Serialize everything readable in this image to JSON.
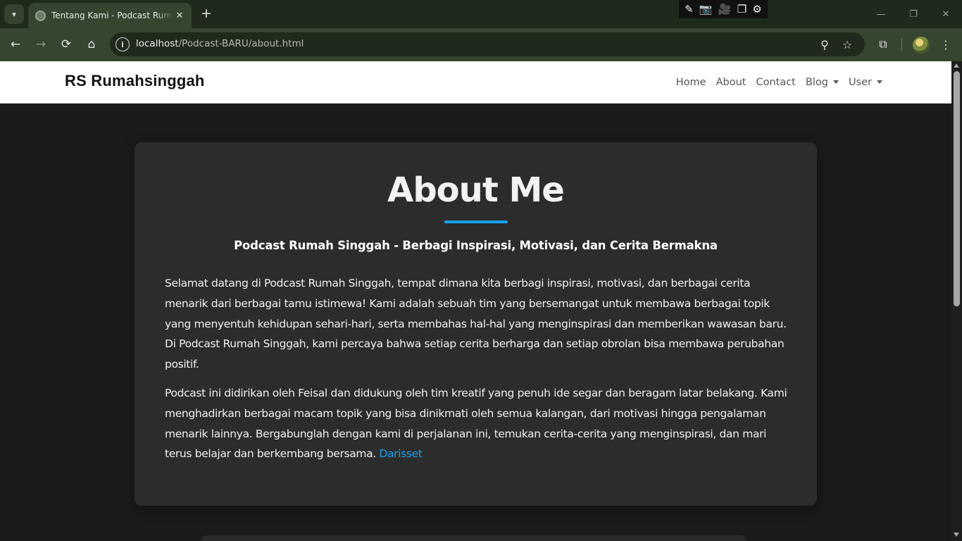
{
  "browser": {
    "tab": {
      "title": "Tentang Kami - Podcast Rumah Singgah",
      "favicon": "globe-icon"
    },
    "url": {
      "host": "localhost",
      "path": "/Podcast-BARU/about.html"
    },
    "icons": {
      "tab_list": "▾",
      "tab_close": "✕",
      "new_tab": "+",
      "back": "←",
      "forward": "→",
      "reload": "⟳",
      "home": "⌂",
      "site_info": "i",
      "zoom": "⚲",
      "bookmark": "☆",
      "extensions": "⧉",
      "menu": "⋮",
      "minimize": "—",
      "restore": "❐",
      "close": "✕"
    },
    "capture_toolbar": [
      "✎",
      "📷",
      "🎥",
      "❐",
      "⚙"
    ]
  },
  "navbar": {
    "brand": "RS Rumahsinggah",
    "items": [
      {
        "label": "Home"
      },
      {
        "label": "About"
      },
      {
        "label": "Contact"
      },
      {
        "label": "Blog",
        "dropdown": true
      },
      {
        "label": "User",
        "dropdown": true
      }
    ]
  },
  "about": {
    "title": "About Me",
    "subtitle": "Podcast Rumah Singgah - Berbagi Inspirasi, Motivasi, dan Cerita Bermakna",
    "paragraph1": "Selamat datang di Podcast Rumah Singgah, tempat dimana kita berbagi inspirasi, motivasi, dan berbagai cerita menarik dari berbagai tamu istimewa! Kami adalah sebuah tim yang bersemangat untuk membawa berbagai topik yang menyentuh kehidupan sehari-hari, serta membahas hal-hal yang menginspirasi dan memberikan wawasan baru. Di Podcast Rumah Singgah, kami percaya bahwa setiap cerita berharga dan setiap obrolan bisa membawa perubahan positif.",
    "paragraph2": "Podcast ini didirikan oleh Feisal dan didukung oleh tim kreatif yang penuh ide segar dan beragam latar belakang. Kami menghadirkan berbagai macam topik yang bisa dinikmati oleh semua kalangan, dari motivasi hingga pengalaman menarik lainnya. Bergabunglah dengan kami di perjalanan ini, temukan cerita-cerita yang menginspirasi, dan mari terus belajar dan berkembang bersama.",
    "link_label": "Darisset"
  },
  "colors": {
    "accent": "#17a2f2",
    "page_background": "#1b1b1b",
    "card_background": "#2c2c2c",
    "browser_frame": "#35452f"
  }
}
